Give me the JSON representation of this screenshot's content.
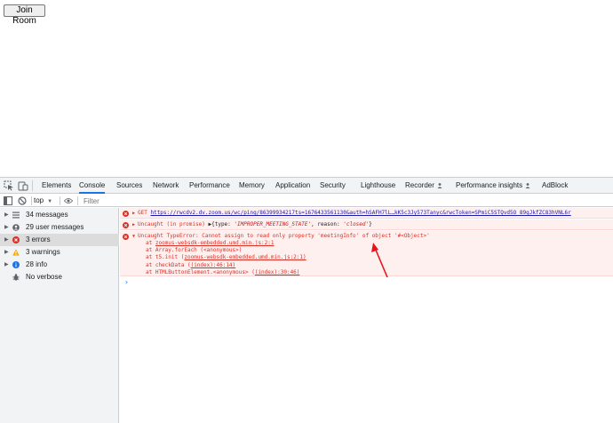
{
  "page": {
    "join_button": "Join Room"
  },
  "devtools": {
    "tabs": [
      {
        "label": "Elements",
        "active": false
      },
      {
        "label": "Console",
        "active": true
      },
      {
        "label": "Sources",
        "active": false
      },
      {
        "label": "Network",
        "active": false
      },
      {
        "label": "Performance",
        "active": false
      },
      {
        "label": "Memory",
        "active": false
      },
      {
        "label": "Application",
        "active": false
      },
      {
        "label": "Security",
        "active": false
      },
      {
        "label": "Lighthouse",
        "active": false
      },
      {
        "label": "Recorder",
        "active": false
      },
      {
        "label": "Performance insights",
        "active": false
      },
      {
        "label": "AdBlock",
        "active": false
      }
    ],
    "toolbar": {
      "context": "top",
      "filter_placeholder": "Filter"
    },
    "sidebar": [
      {
        "label": "34 messages",
        "icon": "list-icon",
        "selected": false
      },
      {
        "label": "29 user messages",
        "icon": "user-icon",
        "selected": false
      },
      {
        "label": "3 errors",
        "icon": "error-icon",
        "selected": true
      },
      {
        "label": "3 warnings",
        "icon": "warning-icon",
        "selected": false
      },
      {
        "label": "28 info",
        "icon": "info-icon",
        "selected": false
      },
      {
        "label": "No verbose",
        "icon": "bug-icon",
        "selected": false
      }
    ],
    "messages": {
      "m1": {
        "method": "GET",
        "url": "https://rwcdv2.dv.zoom.us/wc/ping/86399934217ts=1676433561130&auth=hSAFH7lL…kK5c3Jy573Tanyc&rwcToken=SPmiC5STQvd5O_89gJkfZC83hVNL6r"
      },
      "m2": {
        "prefix": "Uncaught (in promise)",
        "obj_open": "{type: ",
        "type_val": "'IMPROPER_MEETING_STATE'",
        "mid": ", reason: ",
        "reason_val": "'closed'",
        "obj_close": "}"
      },
      "m3": {
        "text": "Uncaught TypeError: Cannot assign to read only property 'meetingInfo' of object '#<Object>'",
        "stack": [
          {
            "at": "at ",
            "fn": "",
            "loc": "zoomus-websdk-embedded.umd.min.js:2:1"
          },
          {
            "at": "at Array.forEach ",
            "fn": "",
            "loc": "(<anonymous>)"
          },
          {
            "at": "at t5.init (",
            "fn": "",
            "loc": "zoomus-websdk-embedded.umd.min.js:2:1)"
          },
          {
            "at": "at checkData (",
            "fn": "",
            "loc": "(index):46:14)"
          },
          {
            "at": "at HTMLButtonElement.<anonymous> (",
            "fn": "",
            "loc": "(index):30:46)"
          }
        ]
      }
    }
  },
  "colors": {
    "accent": "#1a73e8",
    "error": "#d93025",
    "error_bg": "#fff0f0",
    "warning": "#f9ab00",
    "annotation": "#e8141c"
  }
}
